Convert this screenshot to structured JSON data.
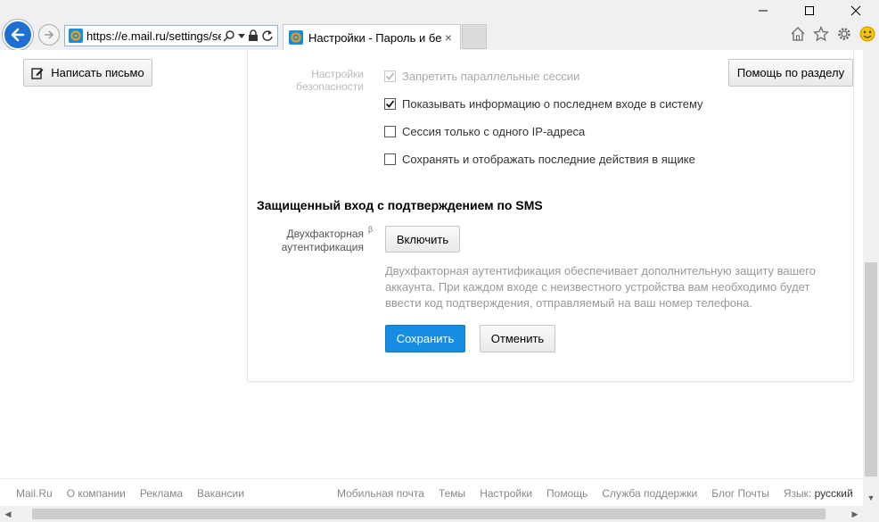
{
  "browser": {
    "url": "https://e.mail.ru/settings/se",
    "tab_title": "Настройки - Пароль и без...",
    "tab_close": "×"
  },
  "toolbar": {
    "compose_label": "Написать письмо",
    "help_label": "Помощь по разделу"
  },
  "security": {
    "section_label": "Настройки безопасности",
    "options": [
      {
        "label": "Запретить параллельные сессии",
        "checked": true,
        "disabled": true
      },
      {
        "label": "Показывать информацию о последнем входе в систему",
        "checked": true,
        "disabled": false
      },
      {
        "label": "Сессия только с одного IP-адреса",
        "checked": false,
        "disabled": false
      },
      {
        "label": "Сохранять и отображать последние действия в ящике",
        "checked": false,
        "disabled": false
      }
    ]
  },
  "sms": {
    "title": "Защищенный вход с подтверждением по SMS",
    "tfa_label": "Двухфакторная аутентификация",
    "beta_mark": "β",
    "enable_label": "Включить",
    "description": "Двухфакторная аутентификация обеспечивает дополнительную защиту вашего аккаунта. При каждом входе с неизвестного устройства вам необходимо будет ввести код подтверждения, отправляемый на ваш номер телефона."
  },
  "actions": {
    "save_label": "Сохранить",
    "cancel_label": "Отменить"
  },
  "footer": {
    "left_links": [
      "Mail.Ru",
      "О компании",
      "Реклама",
      "Вакансии"
    ],
    "right_links": [
      "Мобильная почта",
      "Темы",
      "Настройки",
      "Помощь",
      "Служба поддержки",
      "Блог Почты"
    ],
    "lang_label": "Язык:",
    "lang_value": "русский"
  },
  "colors": {
    "primary_button": "#168de2",
    "back_button": "#1e6fd1"
  }
}
